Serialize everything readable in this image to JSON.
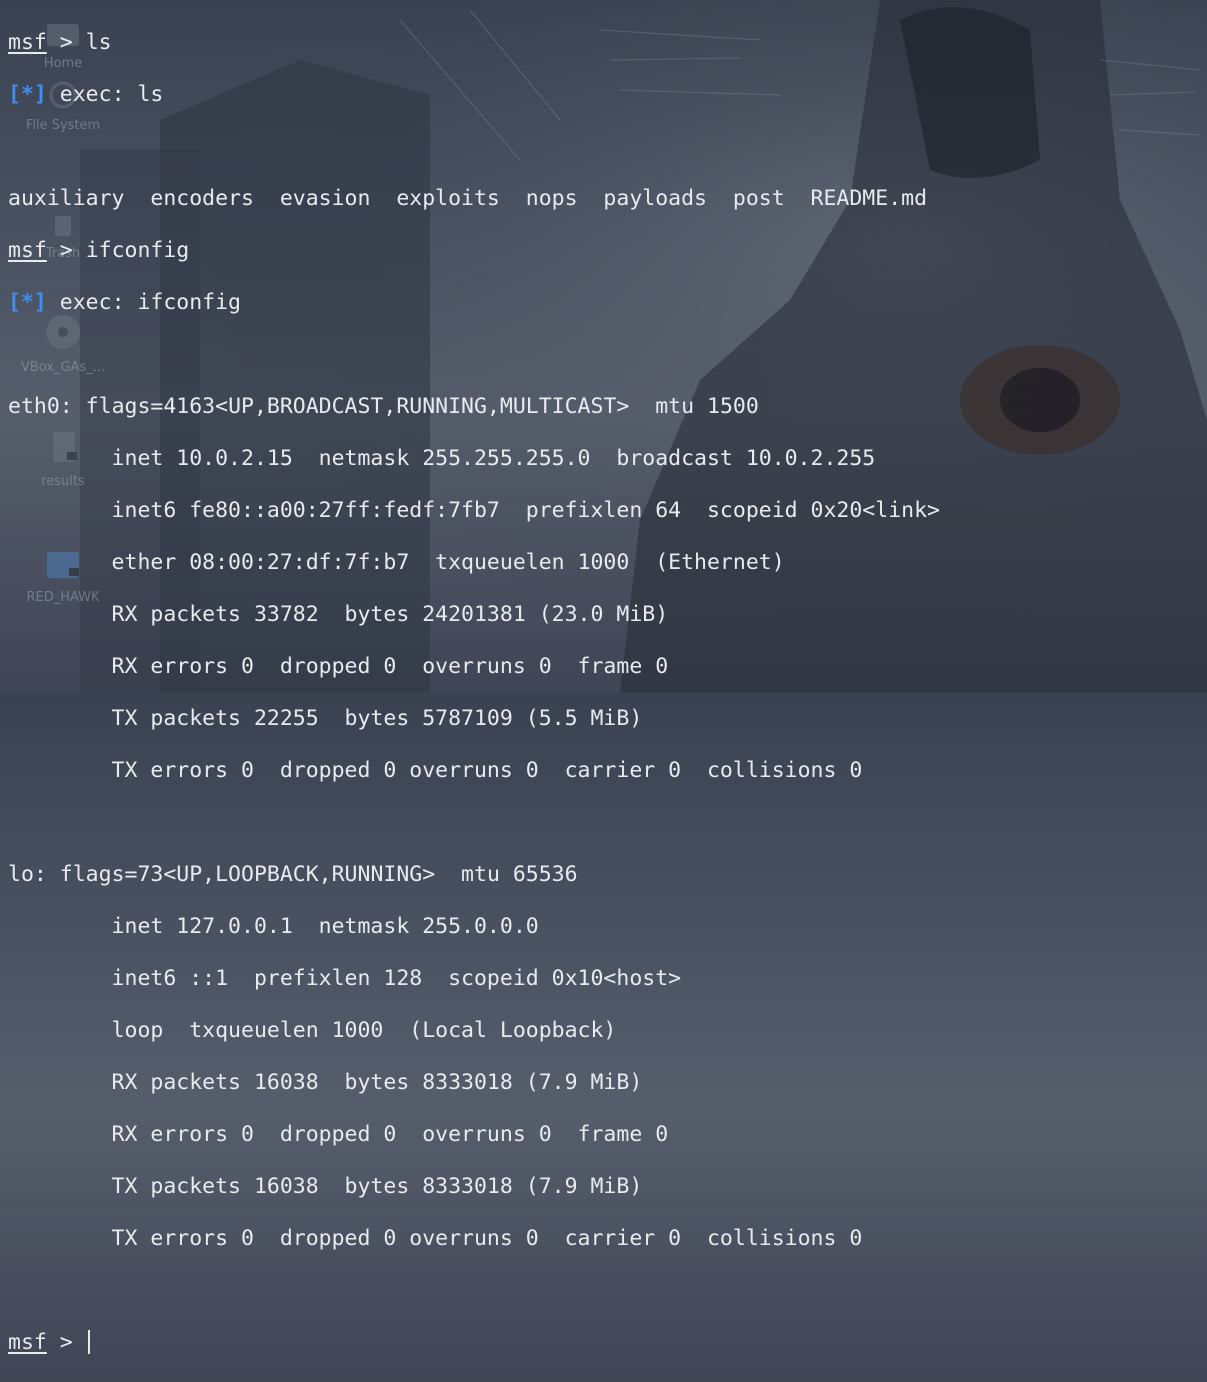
{
  "desktop": {
    "icons": [
      {
        "label": "Home",
        "icon": "home-folder-icon"
      },
      {
        "label": "File System",
        "icon": "drive-icon"
      },
      {
        "label": "Trash",
        "icon": "trash-icon"
      },
      {
        "label": "VBox_GAs_...",
        "icon": "disc-icon"
      },
      {
        "label": "results",
        "icon": "locked-file-icon"
      },
      {
        "label": "RED_HAWK",
        "icon": "locked-folder-icon"
      }
    ]
  },
  "terminal": {
    "prompt_name": "msf",
    "prompt_sep": " > ",
    "exec_marker": "[*]",
    "lines": {
      "cmd_ls": "ls",
      "exec_ls": " exec: ls",
      "ls_output": "auxiliary  encoders  evasion  exploits  nops  payloads  post  README.md",
      "cmd_ifconfig": "ifconfig",
      "exec_ifconfig": " exec: ifconfig",
      "eth0_iface": "eth0:",
      "eth0_flags": " flags=4163<UP,BROADCAST,RUNNING,MULTICAST>  mtu 1500",
      "eth0_inet": "        inet 10.0.2.15  netmask 255.255.255.0  broadcast 10.0.2.255",
      "eth0_inet6": "        inet6 fe80::a00:27ff:fedf:7fb7  prefixlen 64  scopeid 0x20<link>",
      "eth0_ether": "        ether 08:00:27:df:7f:b7  txqueuelen 1000  (Ethernet)",
      "eth0_rx_packets": "        RX packets 33782  bytes 24201381 (23.0 MiB)",
      "eth0_rx_errors": "        RX errors 0  dropped 0  overruns 0  frame 0",
      "eth0_tx_packets": "        TX packets 22255  bytes 5787109 (5.5 MiB)",
      "eth0_tx_errors": "        TX errors 0  dropped 0 overruns 0  carrier 0  collisions 0",
      "lo_iface": "lo:",
      "lo_flags": " flags=73<UP,LOOPBACK,RUNNING>  mtu 65536",
      "lo_inet": "        inet 127.0.0.1  netmask 255.0.0.0",
      "lo_inet6": "        inet6 ::1  prefixlen 128  scopeid 0x10<host>",
      "lo_loop": "        loop  txqueuelen 1000  (Local Loopback)",
      "lo_rx_packets": "        RX packets 16038  bytes 8333018 (7.9 MiB)",
      "lo_rx_errors": "        RX errors 0  dropped 0  overruns 0  frame 0",
      "lo_tx_packets": "        TX packets 16038  bytes 8333018 (7.9 MiB)",
      "lo_tx_errors": "        TX errors 0  dropped 0 overruns 0  carrier 0  collisions 0"
    }
  },
  "colors": {
    "text": "#e8eaee",
    "exec_marker": "#3d8ff6",
    "background": "#4a5262"
  }
}
